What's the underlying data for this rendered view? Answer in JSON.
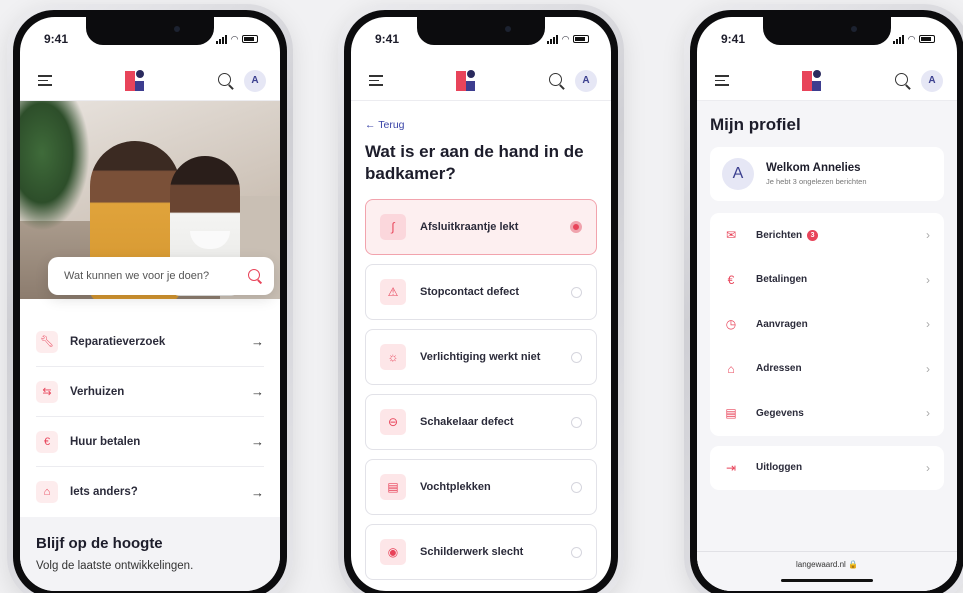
{
  "status": {
    "time": "9:41"
  },
  "user": {
    "initial": "A"
  },
  "home": {
    "search_placeholder": "Wat kunnen we voor je doen?",
    "menu": [
      {
        "label": "Reparatieverzoek",
        "icon": "wrench-icon"
      },
      {
        "label": "Verhuizen",
        "icon": "moving-icon"
      },
      {
        "label": "Huur betalen",
        "icon": "payment-icon"
      },
      {
        "label": "Iets anders?",
        "icon": "house-question-icon"
      }
    ],
    "stay_title": "Blijf op de hoogte",
    "stay_text": "Volg de laatste ontwikkelingen."
  },
  "question": {
    "back": "← Terug",
    "title": "Wat is er aan de hand in de badkamer?",
    "options": [
      {
        "label": "Afsluitkraantje lekt",
        "icon": "faucet-icon",
        "selected": true
      },
      {
        "label": "Stopcontact defect",
        "icon": "warning-icon",
        "selected": false
      },
      {
        "label": "Verlichtiging werkt niet",
        "icon": "lightbulb-icon",
        "selected": false
      },
      {
        "label": "Schakelaar defect",
        "icon": "switch-icon",
        "selected": false
      },
      {
        "label": "Vochtplekken",
        "icon": "wall-icon",
        "selected": false
      },
      {
        "label": "Schilderwerk slecht",
        "icon": "palette-icon",
        "selected": false
      }
    ]
  },
  "profile": {
    "title": "Mijn profiel",
    "welcome_name": "Welkom Annelies",
    "welcome_sub": "Je hebt 3 ongelezen berichten",
    "menu": [
      {
        "label": "Berichten",
        "icon": "mail-icon",
        "badge": "3"
      },
      {
        "label": "Betalingen",
        "icon": "payment-icon",
        "badge": ""
      },
      {
        "label": "Aanvragen",
        "icon": "clock-icon",
        "badge": ""
      },
      {
        "label": "Adressen",
        "icon": "home-icon",
        "badge": ""
      },
      {
        "label": "Gegevens",
        "icon": "document-icon",
        "badge": ""
      }
    ],
    "logout": "Uitloggen",
    "footer_url": "langewaard.nl 🔒"
  },
  "colors": {
    "accent": "#e8445a",
    "brand_dark": "#3d3d8f",
    "link": "#3b45a8"
  }
}
